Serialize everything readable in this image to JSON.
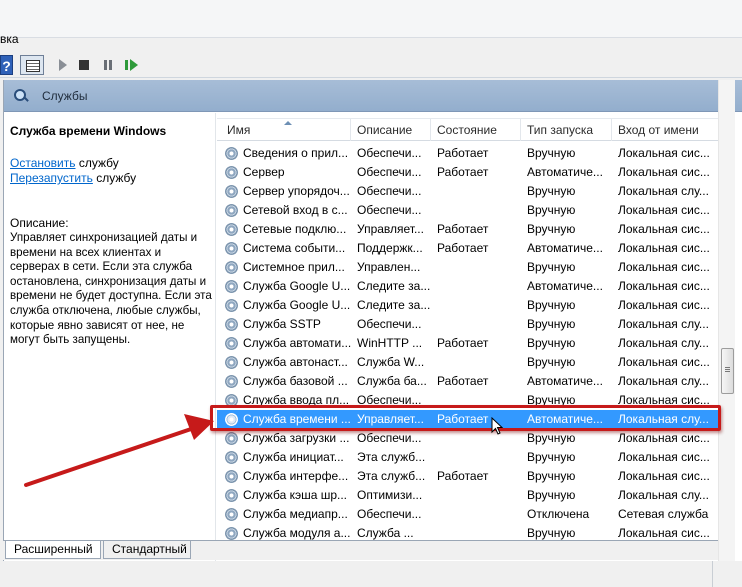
{
  "menubar": {
    "cut_text": "вка"
  },
  "toolbar": {
    "items": [
      "help-icon",
      "view-icon",
      "play-icon",
      "stop-icon",
      "pause-icon",
      "resume-icon"
    ]
  },
  "panel": {
    "title": "Службы"
  },
  "details": {
    "service_name": "Служба времени Windows",
    "stop_link": "Остановить",
    "stop_suffix": " службу",
    "restart_link": "Перезапустить",
    "restart_suffix": " службу",
    "description_label": "Описание:",
    "description": "Управляет синхронизацией даты и времени на всех клиентах и серверах в сети. Если эта служба остановлена, синхронизация даты и времени не будет доступна. Если эта служба отключена, любые службы, которые явно зависят от нее, не могут быть запущены."
  },
  "columns": {
    "name": "Имя",
    "description": "Описание",
    "state": "Состояние",
    "startup": "Тип запуска",
    "logon": "Вход от имени"
  },
  "rows": [
    {
      "name": "Сведения о прил...",
      "description": "Обеспечи...",
      "state": "Работает",
      "startup": "Вручную",
      "logon": "Локальная сис..."
    },
    {
      "name": "Сервер",
      "description": "Обеспечи...",
      "state": "Работает",
      "startup": "Автоматиче...",
      "logon": "Локальная сис..."
    },
    {
      "name": "Сервер упорядоч...",
      "description": "Обеспечи...",
      "state": "",
      "startup": "Вручную",
      "logon": "Локальная слу..."
    },
    {
      "name": "Сетевой вход в с...",
      "description": "Обеспечи...",
      "state": "",
      "startup": "Вручную",
      "logon": "Локальная сис..."
    },
    {
      "name": "Сетевые подклю...",
      "description": "Управляет...",
      "state": "Работает",
      "startup": "Вручную",
      "logon": "Локальная сис..."
    },
    {
      "name": "Система событи...",
      "description": "Поддержк...",
      "state": "Работает",
      "startup": "Автоматиче...",
      "logon": "Локальная сис..."
    },
    {
      "name": "Системное прил...",
      "description": "Управлен...",
      "state": "",
      "startup": "Вручную",
      "logon": "Локальная сис..."
    },
    {
      "name": "Служба Google U...",
      "description": "Следите за...",
      "state": "",
      "startup": "Автоматиче...",
      "logon": "Локальная сис..."
    },
    {
      "name": "Служба Google U...",
      "description": "Следите за...",
      "state": "",
      "startup": "Вручную",
      "logon": "Локальная сис..."
    },
    {
      "name": "Служба SSTP",
      "description": "Обеспечи...",
      "state": "",
      "startup": "Вручную",
      "logon": "Локальная слу..."
    },
    {
      "name": "Служба автомати...",
      "description": "WinHTTP ...",
      "state": "Работает",
      "startup": "Вручную",
      "logon": "Локальная слу..."
    },
    {
      "name": "Служба автонаст...",
      "description": "Служба W...",
      "state": "",
      "startup": "Вручную",
      "logon": "Локальная сис..."
    },
    {
      "name": "Служба базовой ...",
      "description": "Служба ба...",
      "state": "Работает",
      "startup": "Автоматиче...",
      "logon": "Локальная слу..."
    },
    {
      "name": "Служба ввода пл...",
      "description": "Обеспечи...",
      "state": "",
      "startup": "Вручную",
      "logon": "Локальная сис..."
    },
    {
      "name": "Служба времени ...",
      "description": "Управляет...",
      "state": "Работает",
      "startup": "Автоматиче...",
      "logon": "Локальная слу...",
      "selected": true
    },
    {
      "name": "Служба загрузки ...",
      "description": "Обеспечи...",
      "state": "",
      "startup": "Вручную",
      "logon": "Локальная сис..."
    },
    {
      "name": "Служба инициат...",
      "description": "Эта служб...",
      "state": "",
      "startup": "Вручную",
      "logon": "Локальная сис..."
    },
    {
      "name": "Служба интерфе...",
      "description": "Эта служб...",
      "state": "Работает",
      "startup": "Вручную",
      "logon": "Локальная сис..."
    },
    {
      "name": "Служба кэша шр...",
      "description": "Оптимизи...",
      "state": "",
      "startup": "Вручную",
      "logon": "Локальная слу..."
    },
    {
      "name": "Служба медиапр...",
      "description": "Обеспечи...",
      "state": "",
      "startup": "Отключена",
      "logon": "Сетевая служба"
    },
    {
      "name": "Служба модуля а...",
      "description": "Служба ...",
      "state": "",
      "startup": "Вручную",
      "logon": "Локальная сис..."
    }
  ],
  "tabs": {
    "extended": "Расширенный",
    "standard": "Стандартный"
  },
  "colors": {
    "selection": "#3399ff",
    "annotation": "#c61a1a",
    "header": "#a7bdd7"
  }
}
